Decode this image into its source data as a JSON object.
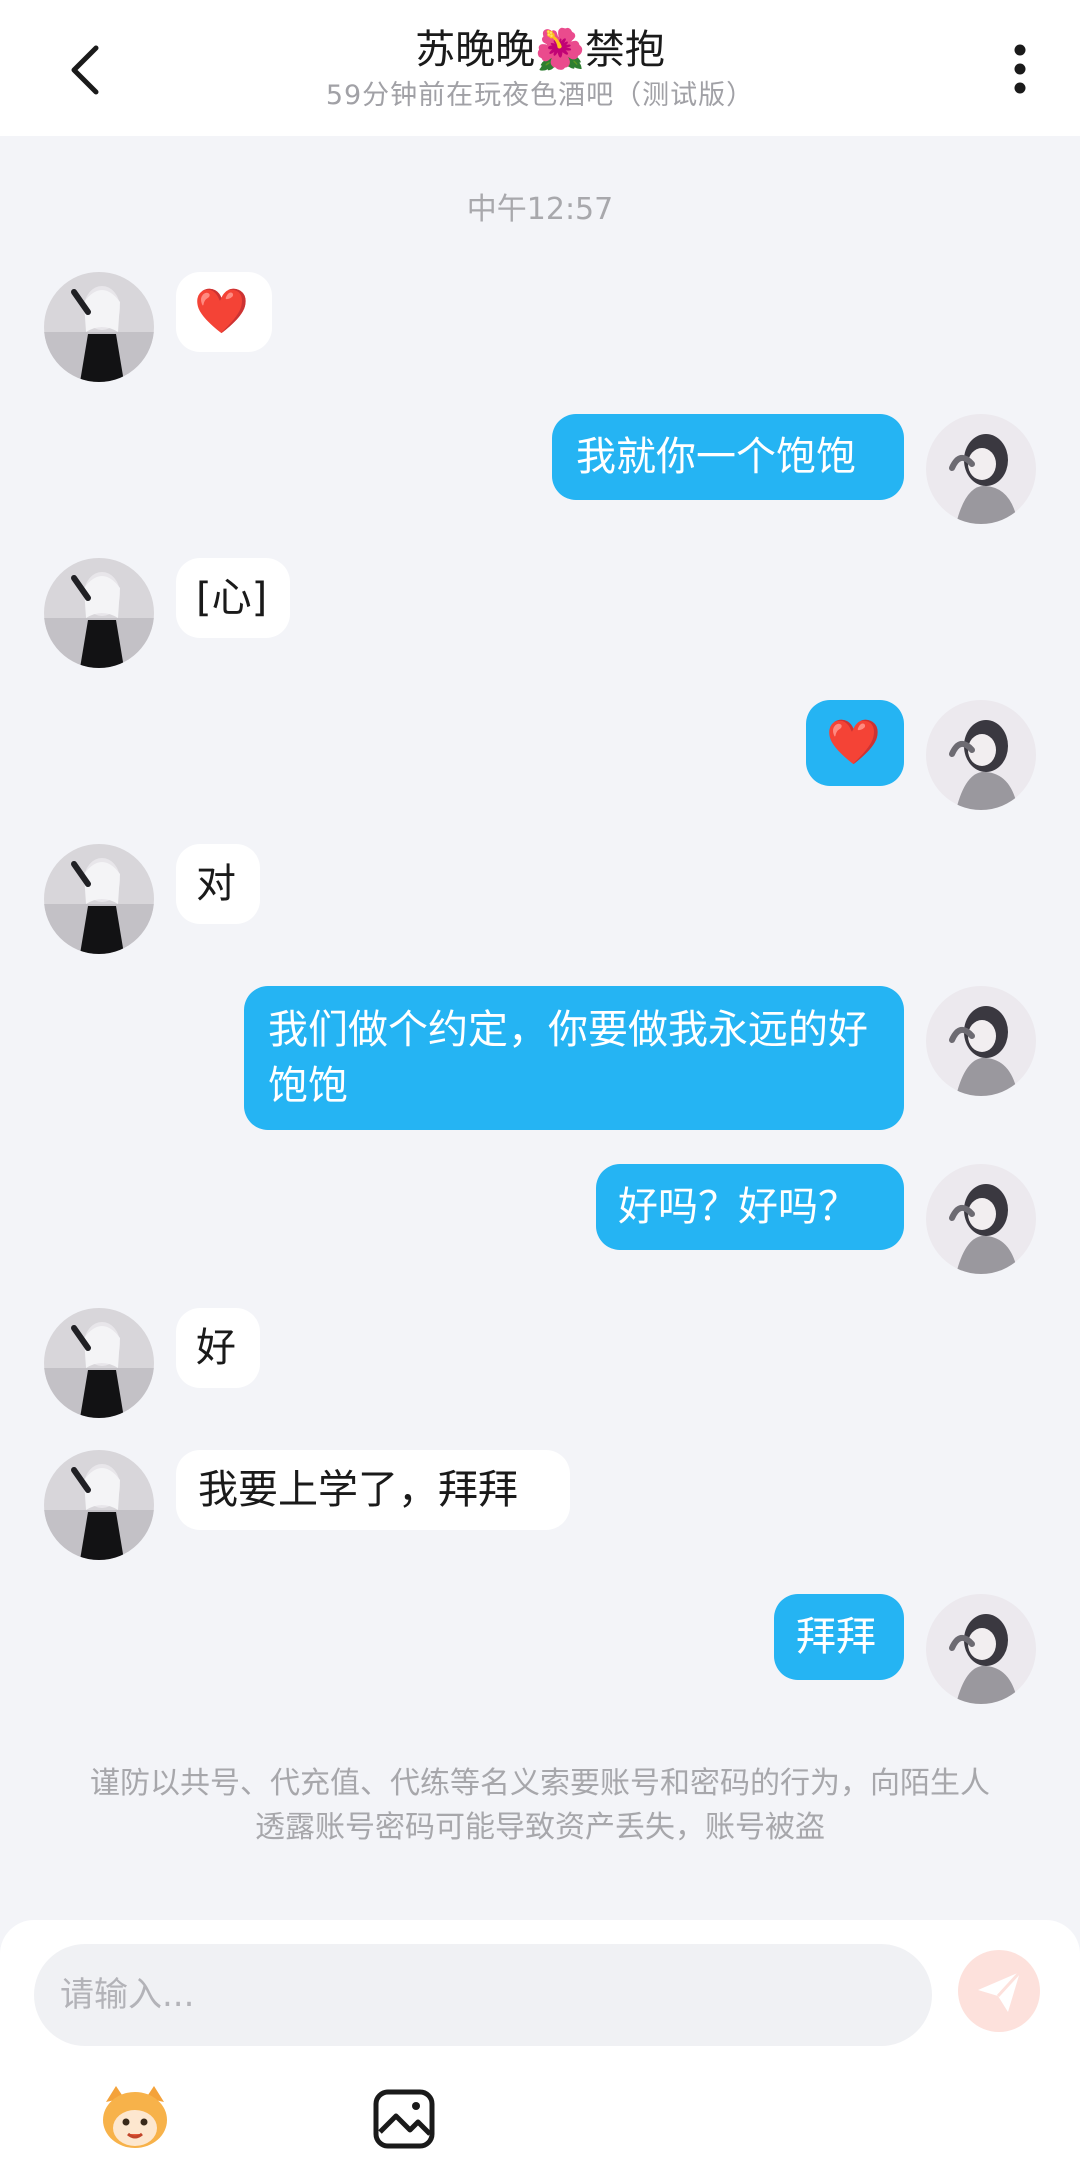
{
  "header": {
    "title": "苏晚晚🌺禁抱",
    "subtitle": "59分钟前在玩夜色酒吧（测试版）"
  },
  "chat": {
    "time": "中午12:57",
    "messages": [
      {
        "side": "left",
        "text": "❤️"
      },
      {
        "side": "right",
        "text": "我就你一个饱饱"
      },
      {
        "side": "left",
        "text": "[心]"
      },
      {
        "side": "right",
        "text": "❤️"
      },
      {
        "side": "left",
        "text": "对"
      },
      {
        "side": "right",
        "text": "我们做个约定，你要做我永远的好饱饱"
      },
      {
        "side": "right",
        "text": "好吗？好吗？"
      },
      {
        "side": "left",
        "text": "好"
      },
      {
        "side": "left",
        "text": "我要上学了，拜拜"
      },
      {
        "side": "right",
        "text": "拜拜"
      }
    ]
  },
  "notice": "谨防以共号、代充值、代练等名义索要账号和密码的行为，向陌生人透露账号密码可能导致资产丢失，账号被盗",
  "composer": {
    "placeholder": "请输入...",
    "icons": [
      "emoji-mascot-icon",
      "image-icon",
      "send-icon"
    ]
  },
  "colors": {
    "accent": "#25b4f3",
    "background": "#f3f4f8",
    "send_disabled": "#fde1dc"
  }
}
